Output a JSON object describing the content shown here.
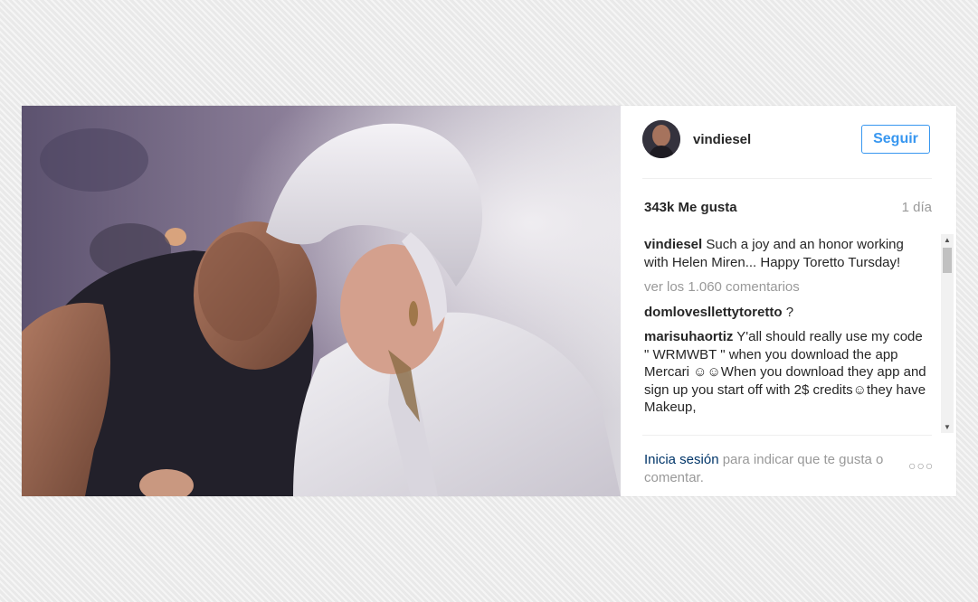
{
  "post": {
    "username": "vindiesel",
    "follow_label": "Seguir",
    "likes": "343k Me gusta",
    "time": "1 día",
    "caption": {
      "user": "vindiesel",
      "text": " Such a joy and an honor working with Helen Miren... Happy Toretto Tursday!"
    },
    "view_comments": "ver los 1.060 comentarios",
    "comments": [
      {
        "user": "domlovesllettytoretto",
        "text": " ?"
      },
      {
        "user": "marisuhaortiz",
        "text": " Y'all should really use my code \" WRMWBT \" when you download the app Mercari ☺☺When you download they app and sign up you start off with 2$ credits☺they have Makeup,"
      }
    ],
    "login_link": "Inicia sesión",
    "login_rest": " para indicar que te gusta o comentar.",
    "options_icon": "more-options-icon",
    "image_description_icon": "photo"
  }
}
